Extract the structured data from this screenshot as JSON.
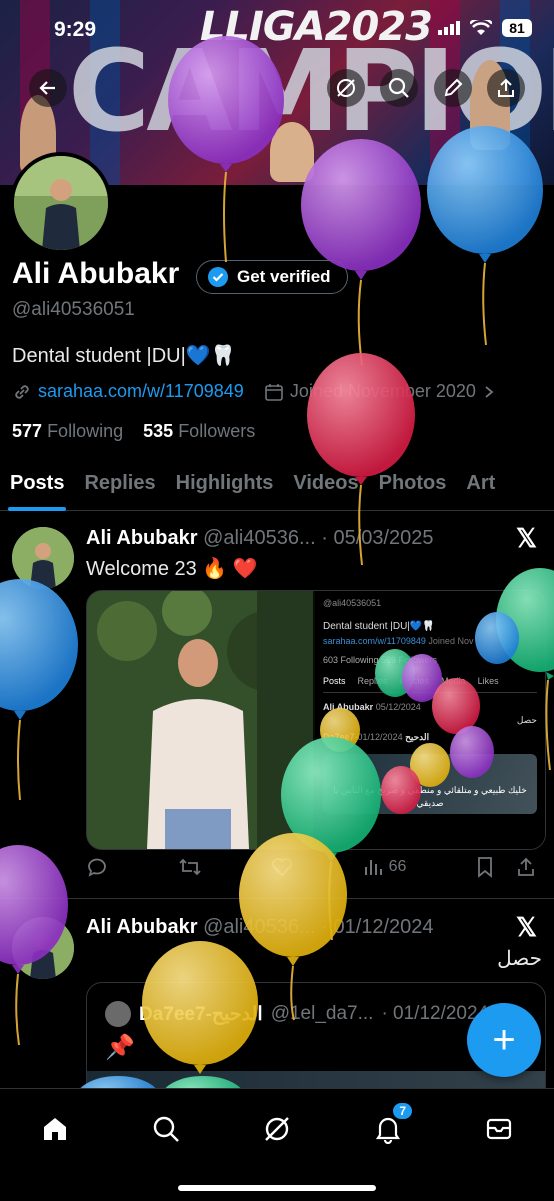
{
  "status_bar": {
    "time": "9:29",
    "battery": "81"
  },
  "banner": {
    "headline": "LLIGA2023",
    "big_letters": "CAMPIONS"
  },
  "profile": {
    "name": "Ali Abubakr",
    "verify_label": "Get verified",
    "handle": "@ali40536051",
    "bio": "Dental student |DU|💙🦷",
    "link": "sarahaa.com/w/11709849",
    "joined": "Joined November 2020",
    "following_count": "577",
    "following_label": "Following",
    "followers_count": "535",
    "followers_label": "Followers"
  },
  "tabs": [
    "Posts",
    "Replies",
    "Highlights",
    "Videos",
    "Photos",
    "Art"
  ],
  "posts": [
    {
      "name": "Ali Abubakr",
      "handle": "@ali40536...",
      "date": "· 05/03/2025",
      "text": "Welcome 23 🔥 ❤️",
      "views": "66",
      "embedded": {
        "handle": "@ali40536051",
        "bio": "Dental student |DU|💙🦷",
        "link": "sarahaa.com/w/11709849",
        "joined": "Joined Nov",
        "stats": "603 Following   569 Followers",
        "tabs": [
          "Posts",
          "Replies",
          "Articles",
          "Media",
          "Likes"
        ],
        "name": "Ali Abubakr",
        "date": "05/12/2024",
        "reply": "حصل",
        "quoted_name": "Da7ee7-الدحيح",
        "quoted_date": "01/12/2024",
        "caption": "خليك طبيعي و متلقائي و منطقي و صريح مع الناس يا صديقي"
      }
    },
    {
      "name": "Ali Abubakr",
      "handle": "@ali40536...",
      "date": "· 01/12/2024",
      "text": "حصل",
      "quoted_name": "Da7ee7-الدحيح",
      "quoted_handle": "@1el_da7...",
      "quoted_date": "· 01/12/2024"
    }
  ],
  "fab_label": "+",
  "notifications_badge": "7",
  "colors": {
    "accent": "#1d9bf0",
    "background": "#000000",
    "muted": "#71767b"
  }
}
